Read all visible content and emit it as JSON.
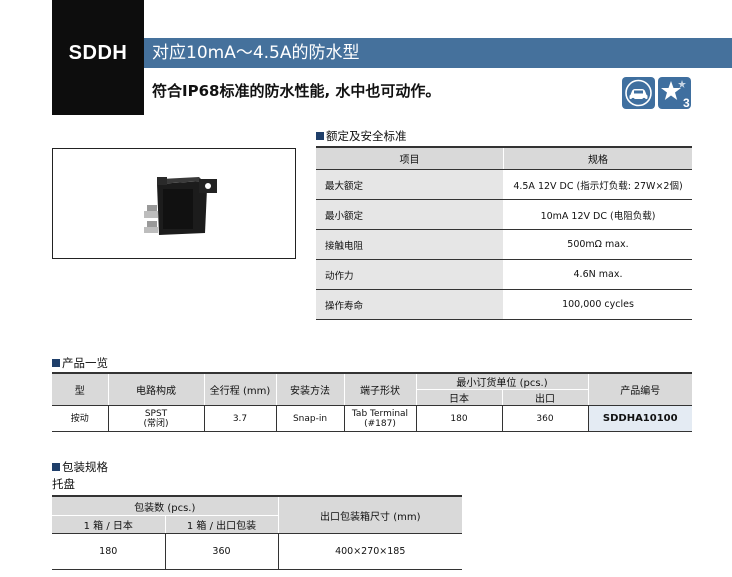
{
  "header": {
    "model": "SDDH",
    "title": "对应10mA～4.5A的防水型",
    "subtitle": "符合IP68标准的防水性能, 水中也可动作。",
    "icon_badge_number": "3"
  },
  "icons": [
    "car-icon",
    "star-rating-icon"
  ],
  "colors": {
    "title_band": "#45719c",
    "header_gray": "#d9d9d9",
    "label_gray": "#e6e6e6",
    "part_no_bg": "#e4ebf3"
  },
  "ratings": {
    "section_title": "额定及安全标准",
    "headers": [
      "项目",
      "规格"
    ],
    "rows": [
      {
        "item": "最大额定",
        "spec": "4.5A 12V DC (指示灯负载: 27W×2個)"
      },
      {
        "item": "最小额定",
        "spec": "10mA 12V DC (电阻负载)"
      },
      {
        "item": "接触电阻",
        "spec": "500mΩ max."
      },
      {
        "item": "动作力",
        "spec": "4.6N max."
      },
      {
        "item": "操作寿命",
        "spec": "100,000 cycles"
      }
    ]
  },
  "products": {
    "section_title": "产品一览",
    "headers": {
      "type": "型",
      "circuit": "电路构成",
      "travel": "全行程 (mm)",
      "mounting": "安装方法",
      "terminal": "端子形状",
      "moq": "最小订货单位 (pcs.)",
      "moq_japan": "日本",
      "moq_export": "出口",
      "part_no": "产品编号"
    },
    "rows": [
      {
        "type": "按动",
        "circuit_1": "SPST",
        "circuit_2": "(常闭)",
        "travel": "3.7",
        "mounting": "Snap-in",
        "terminal_1": "Tab Terminal",
        "terminal_2": "(#187)",
        "moq_japan": "180",
        "moq_export": "360",
        "part_no": "SDDHA10100"
      }
    ]
  },
  "packaging": {
    "section_title": "包装规格",
    "tray_label": "托盘",
    "headers": {
      "qty": "包装数 (pcs.)",
      "qty_japan": "1 箱 / 日本",
      "qty_export": "1 箱 / 出口包装",
      "box_size": "出口包装箱尺寸 (mm)"
    },
    "row": {
      "qty_japan": "180",
      "qty_export": "360",
      "box_size": "400×270×185"
    }
  }
}
